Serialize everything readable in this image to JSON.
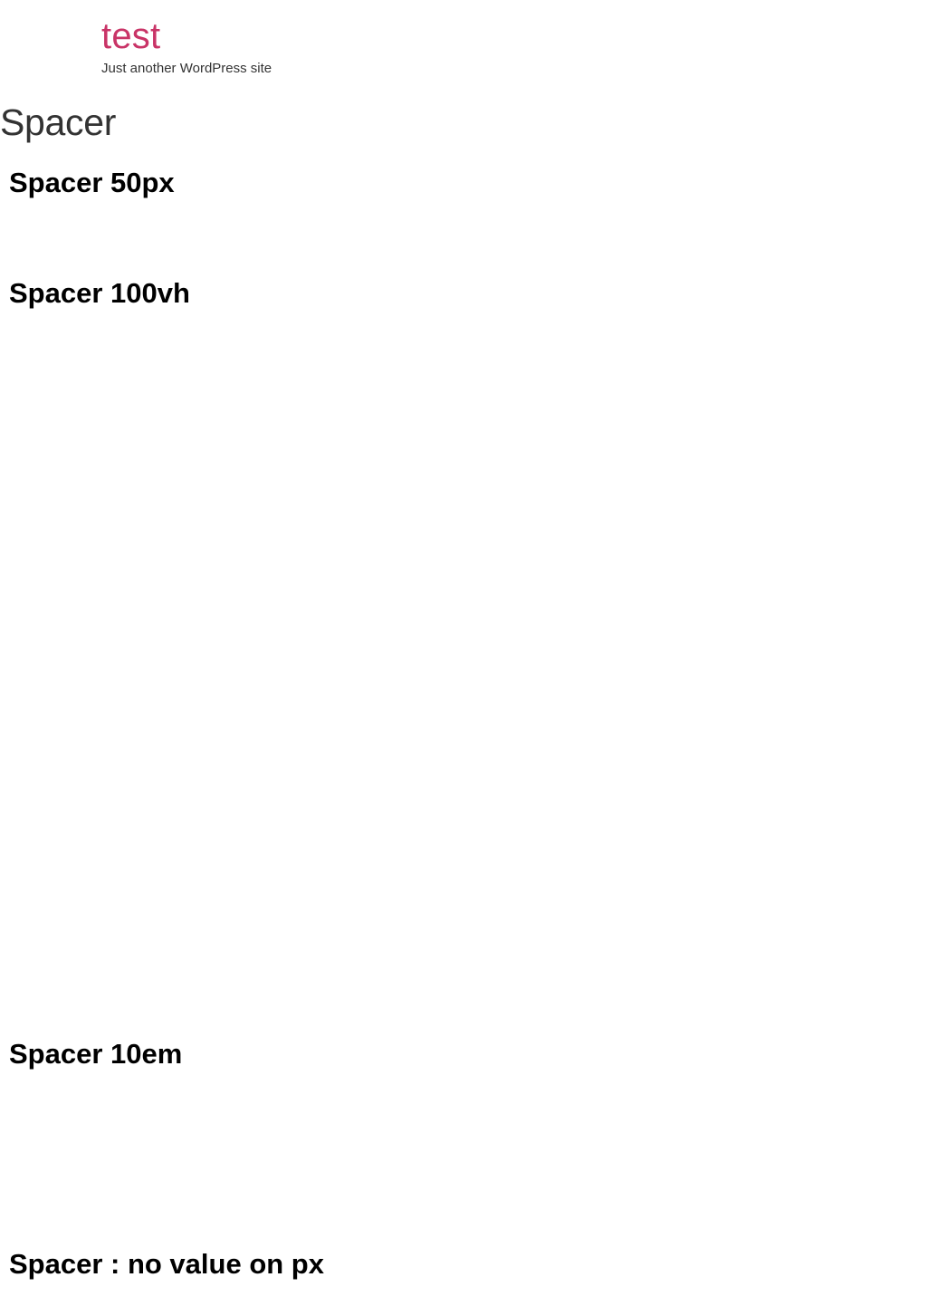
{
  "site": {
    "title": "test",
    "tagline": "Just another WordPress site"
  },
  "page": {
    "title": "Spacer"
  },
  "blocks": [
    {
      "heading": "Spacer 50px"
    },
    {
      "heading": "Spacer 100vh"
    },
    {
      "heading": "Spacer 10em"
    },
    {
      "heading": "Spacer : no value on px"
    }
  ],
  "colors": {
    "site_title": "#c93467",
    "text": "#333333",
    "heading": "#000000",
    "background": "#ffffff"
  }
}
